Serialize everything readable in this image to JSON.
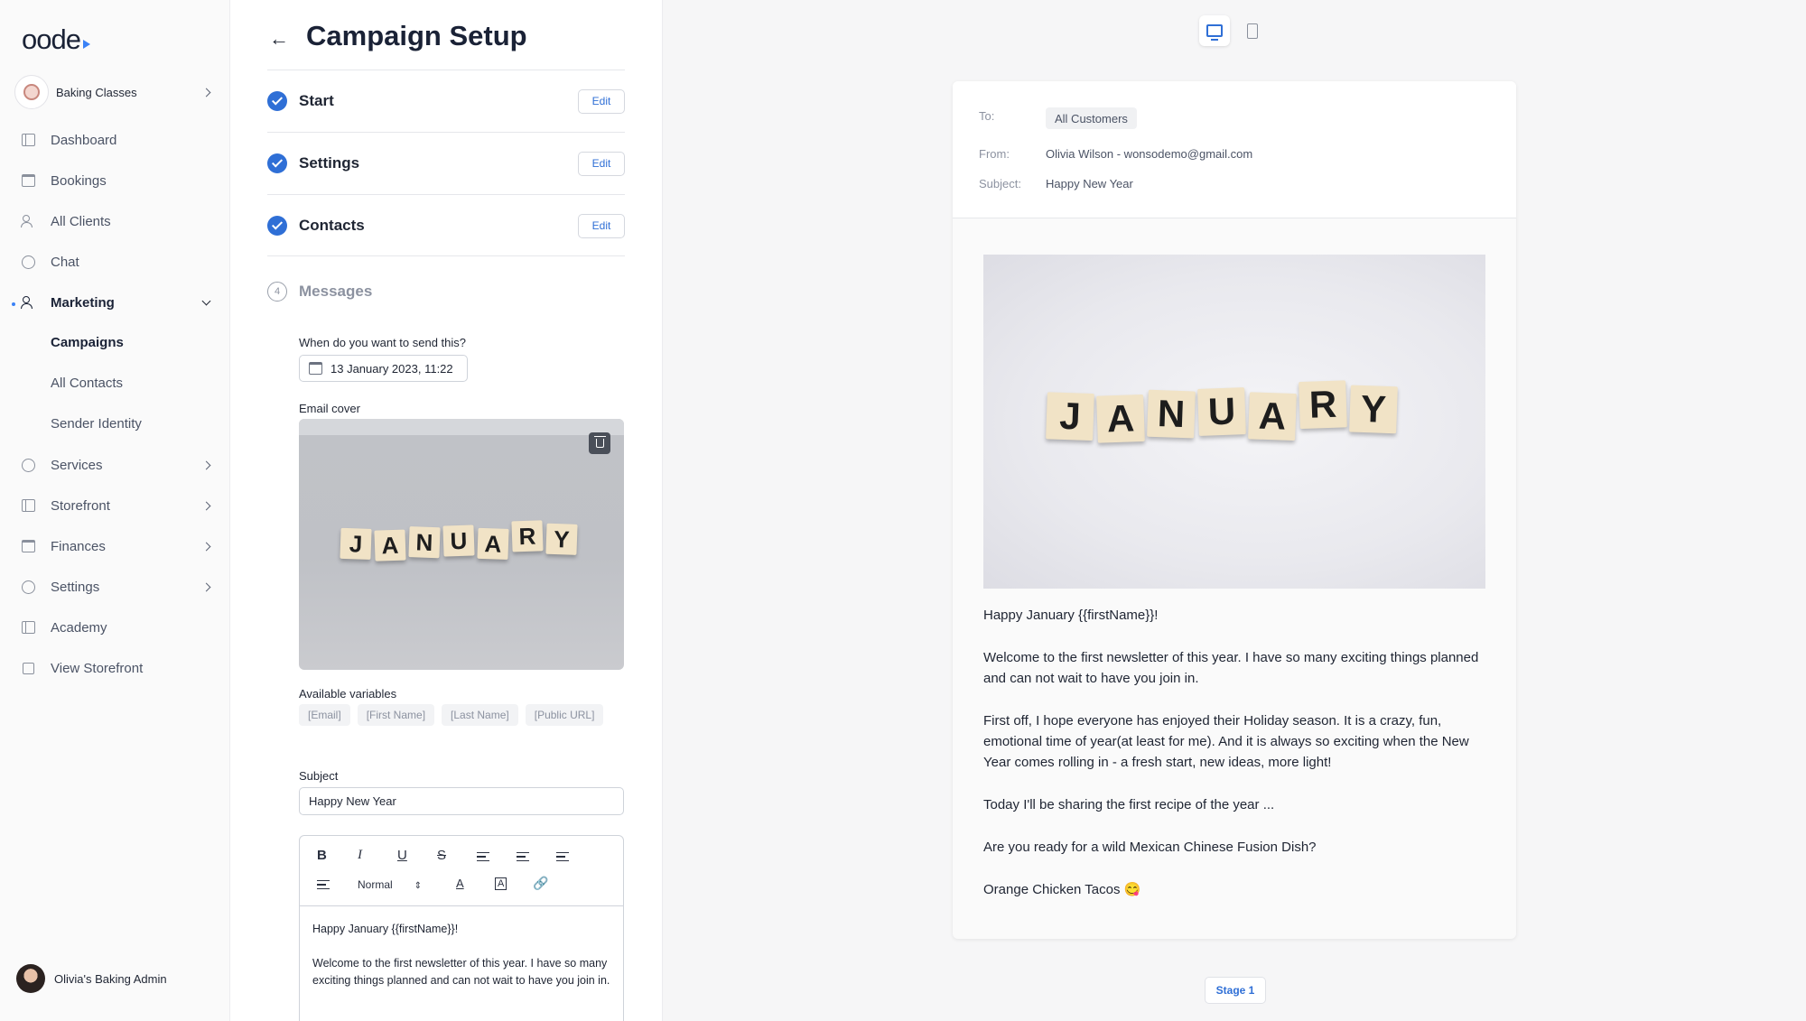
{
  "app": {
    "logo": "oode"
  },
  "sidebar": {
    "business": "Baking Classes",
    "items": [
      {
        "label": "Dashboard",
        "icon": "dashboard-icon"
      },
      {
        "label": "Bookings",
        "icon": "calendar-icon"
      },
      {
        "label": "All Clients",
        "icon": "clients-icon"
      },
      {
        "label": "Chat",
        "icon": "chat-icon"
      },
      {
        "label": "Marketing",
        "icon": "marketing-icon",
        "expanded": true
      },
      {
        "label": "Services",
        "icon": "services-icon"
      },
      {
        "label": "Storefront",
        "icon": "storefront-icon"
      },
      {
        "label": "Finances",
        "icon": "finances-icon"
      },
      {
        "label": "Settings",
        "icon": "settings-icon"
      },
      {
        "label": "Academy",
        "icon": "academy-icon"
      },
      {
        "label": "View Storefront",
        "icon": "external-link-icon"
      }
    ],
    "marketing_sub": [
      "Campaigns",
      "All Contacts",
      "Sender Identity"
    ],
    "active_sub": "Campaigns",
    "user": "Olivia's Baking Admin",
    "accent_color": "#3b82f6"
  },
  "setup": {
    "title": "Campaign Setup",
    "steps": [
      {
        "label": "Start",
        "status": "complete",
        "edit": "Edit"
      },
      {
        "label": "Settings",
        "status": "complete",
        "edit": "Edit"
      },
      {
        "label": "Contacts",
        "status": "complete",
        "edit": "Edit"
      },
      {
        "label": "Messages",
        "status": "current",
        "number": "4"
      }
    ],
    "send_label": "When do you want to send this?",
    "send_value": "13 January 2023, 11:22",
    "cover_label": "Email cover",
    "cover_word": [
      "J",
      "A",
      "N",
      "U",
      "A",
      "R",
      "Y"
    ],
    "variables_label": "Available variables",
    "variables": [
      "[Email]",
      "[First Name]",
      "[Last Name]",
      "[Public URL]"
    ],
    "subject_label": "Subject",
    "subject_value": "Happy New Year",
    "editor": {
      "bold": "B",
      "italic": "I",
      "underline": "U",
      "strike": "S",
      "format": "Normal",
      "body": [
        "Happy January {{firstName}}!",
        "Welcome to the first newsletter of this year. I have so many exciting things planned and can not wait to have you join in."
      ]
    }
  },
  "preview": {
    "to_label": "To:",
    "to_value": "All Customers",
    "from_label": "From:",
    "from_value": "Olivia Wilson - wonsodemo@gmail.com",
    "subject_label": "Subject:",
    "subject_value": "Happy New Year",
    "body": [
      "Happy January {{firstName}}!",
      "Welcome to the first newsletter of this year. I have so many exciting things planned and can not wait to have you join in.",
      "First off, I hope everyone has enjoyed their Holiday season. It is a crazy, fun, emotional time of year(at least for me). And it is always so exciting when the New Year comes rolling in - a fresh start, new ideas, more light!",
      "Today I'll be sharing the first recipe of the year ...",
      "Are you ready for a wild Mexican Chinese Fusion Dish?",
      "Orange Chicken Tacos 😋"
    ],
    "stage": "Stage 1"
  }
}
